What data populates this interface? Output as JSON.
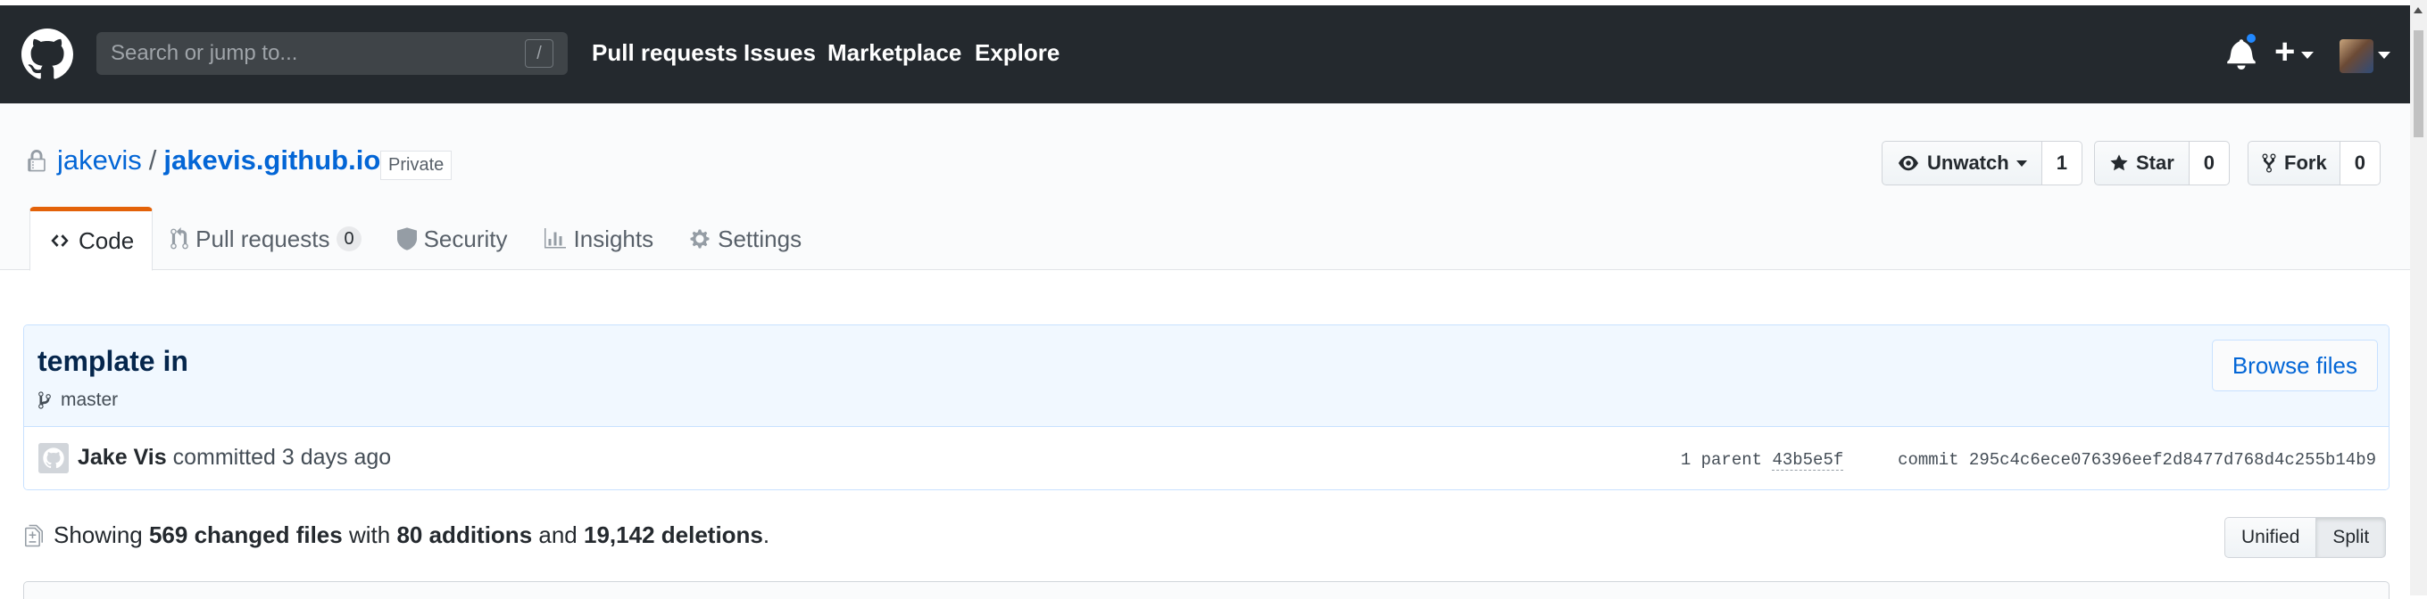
{
  "header": {
    "search_placeholder": "Search or jump to...",
    "search_shortcut": "/",
    "nav": [
      "Pull requests",
      "Issues",
      "Marketplace",
      "Explore"
    ],
    "new_label": "+"
  },
  "repo": {
    "owner": "jakevis",
    "separator": "/",
    "name": "jakevis.github.io",
    "visibility": "Private",
    "watch": {
      "label": "Unwatch",
      "count": "1"
    },
    "star": {
      "label": "Star",
      "count": "0"
    },
    "fork": {
      "label": "Fork",
      "count": "0"
    }
  },
  "tabs": {
    "code": "Code",
    "pull_requests": "Pull requests",
    "pull_requests_count": "0",
    "security": "Security",
    "insights": "Insights",
    "settings": "Settings"
  },
  "commit": {
    "title": "template in",
    "branch": "master",
    "browse_label": "Browse files",
    "author": "Jake Vis",
    "action": "committed",
    "time": "3 days ago",
    "parent_label": "1 parent",
    "parent_sha": "43b5e5f",
    "commit_label": "commit",
    "sha": "295c4c6ece076396eef2d8477d768d4c255b14b9"
  },
  "summary": {
    "showing": "Showing",
    "changed_files": "569 changed files",
    "with": "with",
    "additions": "80 additions",
    "and": "and",
    "deletions": "19,142 deletions",
    "period": "."
  },
  "view_toggle": {
    "unified": "Unified",
    "split": "Split"
  },
  "colors": {
    "header_bg": "#24292e",
    "link": "#0366d6",
    "tab_accent": "#e36209",
    "notification_dot": "#2188ff"
  }
}
